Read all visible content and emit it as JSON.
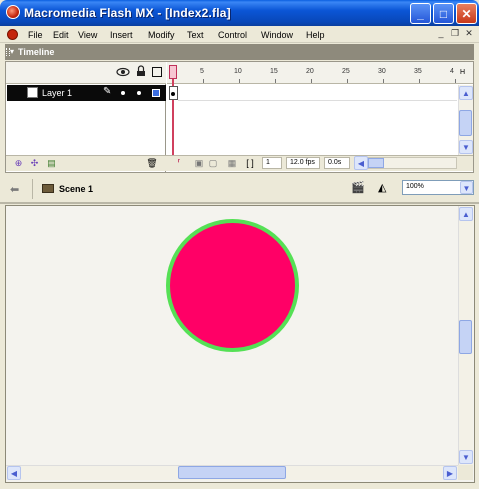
{
  "window": {
    "title": "Macromedia Flash MX - [Index2.fla]",
    "app_icon": "flash-icon",
    "controls": {
      "minimize": "_",
      "maximize": "□",
      "close": "✕"
    }
  },
  "menu": {
    "items": [
      "File",
      "Edit",
      "View",
      "Insert",
      "Modify",
      "Text",
      "Control",
      "Window",
      "Help"
    ],
    "mdi_controls": {
      "minimize": "_",
      "restore": "❐",
      "close": "✕"
    }
  },
  "timeline": {
    "title": "Timeline",
    "toggle_glyph": "▾",
    "ruler_ticks": [
      "5",
      "10",
      "15",
      "20",
      "25",
      "30",
      "35",
      "4"
    ],
    "ruler_end": "H",
    "layers": [
      {
        "name": "Layer 1"
      }
    ],
    "current_frame": "1",
    "frame_rate": "12.0 fps",
    "elapsed": "0.0s"
  },
  "scene_bar": {
    "scene_name": "Scene 1",
    "zoom": "100%"
  },
  "colors": {
    "title_bar": "#0b56d6",
    "circle_fill": "#ff0066",
    "circle_stroke": "#55e055",
    "stage_bg": "#f4f3ee"
  }
}
